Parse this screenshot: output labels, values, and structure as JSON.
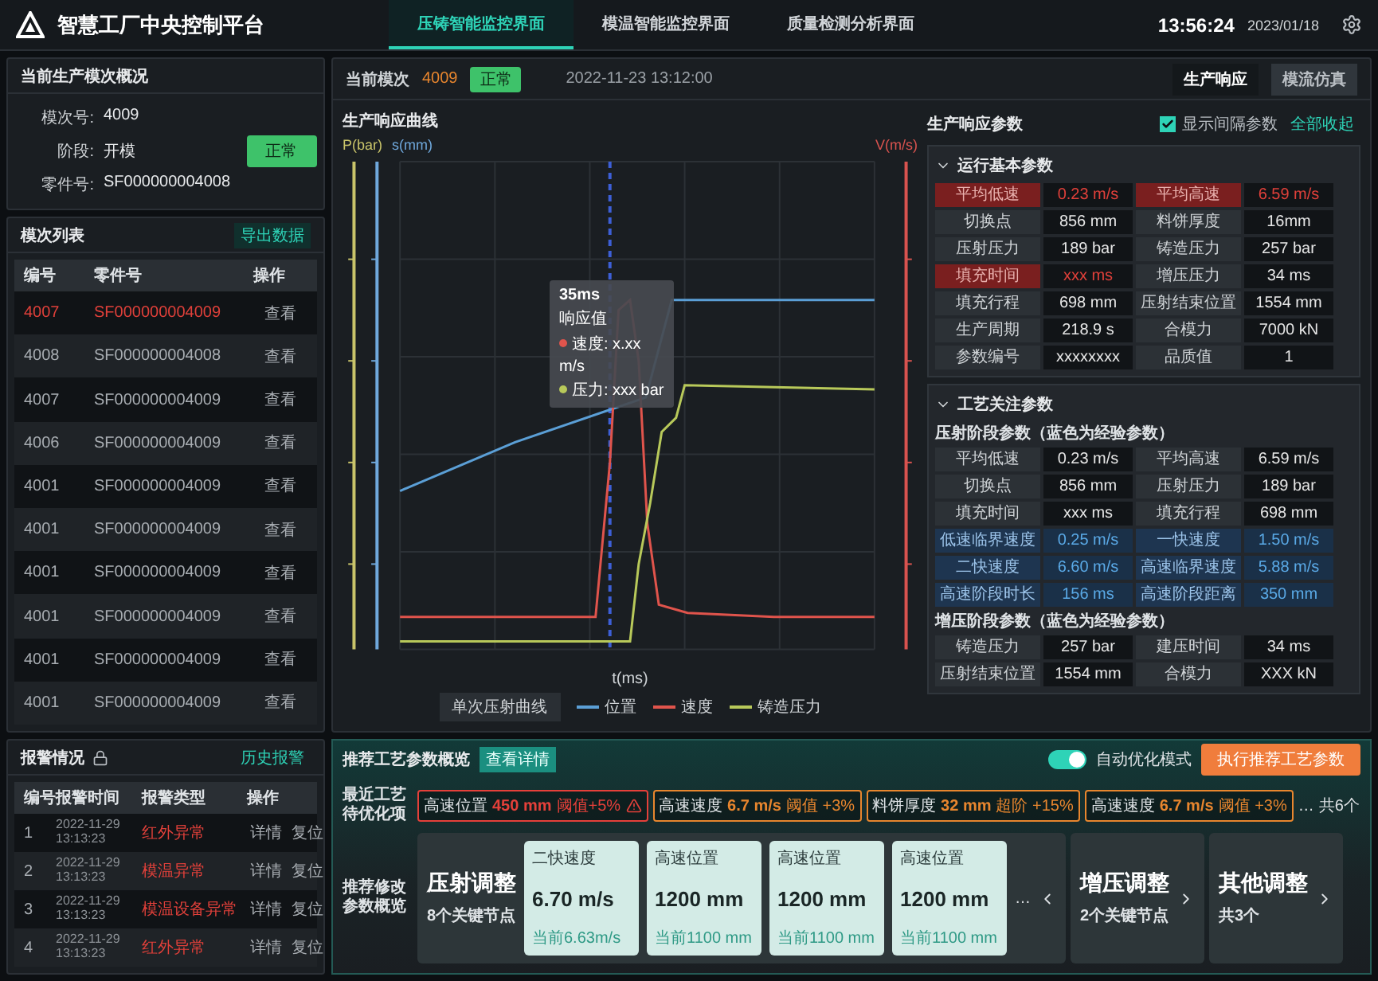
{
  "header": {
    "title": "智慧工厂中央控制平台",
    "tabs": [
      {
        "label": "压铸智能监控界面",
        "selected": true
      },
      {
        "label": "模温智能监控界面",
        "selected": false
      },
      {
        "label": "质量检测分析界面",
        "selected": false
      }
    ],
    "time": "13:56:24",
    "date": "2023/01/18"
  },
  "overview": {
    "title": "当前生产模次概况",
    "fields": [
      {
        "label": "模次号:",
        "value": "4009"
      },
      {
        "label": "阶段:",
        "value": "开模"
      },
      {
        "label": "零件号:",
        "value": "SF000000004008"
      }
    ],
    "status": "正常"
  },
  "cycle_list": {
    "title": "模次列表",
    "action": "导出数据",
    "columns": [
      "编号",
      "零件号",
      "操作"
    ],
    "rows": [
      {
        "id": "4007",
        "part": "SF000000004009",
        "action": "查看",
        "alert": true
      },
      {
        "id": "4008",
        "part": "SF000000004008",
        "action": "查看",
        "alert": false
      },
      {
        "id": "4007",
        "part": "SF000000004009",
        "action": "查看",
        "alert": false
      },
      {
        "id": "4006",
        "part": "SF000000004009",
        "action": "查看",
        "alert": false
      },
      {
        "id": "4001",
        "part": "SF000000004009",
        "action": "查看",
        "alert": false
      },
      {
        "id": "4001",
        "part": "SF000000004009",
        "action": "查看",
        "alert": false
      },
      {
        "id": "4001",
        "part": "SF000000004009",
        "action": "查看",
        "alert": false
      },
      {
        "id": "4001",
        "part": "SF000000004009",
        "action": "查看",
        "alert": false
      },
      {
        "id": "4001",
        "part": "SF000000004009",
        "action": "查看",
        "alert": false
      },
      {
        "id": "4001",
        "part": "SF000000004009",
        "action": "查看",
        "alert": false
      }
    ]
  },
  "center": {
    "label": "当前模次",
    "cycle": "4009",
    "status": "正常",
    "timestamp": "2022-11-23 13:12:00",
    "views": [
      {
        "label": "生产响应",
        "selected": true
      },
      {
        "label": "模流仿真",
        "selected": false
      }
    ]
  },
  "chart": {
    "title": "生产响应曲线",
    "axis_left": [
      "P(bar)",
      "s(mm)"
    ],
    "axis_right": "V(m/s)",
    "axis_bottom": "t(ms)",
    "tooltip": {
      "time": "35ms",
      "heading": "响应值",
      "lines": [
        {
          "text": "速度: x.xx",
          "color": "#e0544c"
        },
        {
          "text": "m/s"
        },
        {
          "text": "压力: xxx bar",
          "color": "#b8c95a"
        }
      ]
    },
    "legend": {
      "series_label": "单次压射曲线",
      "items": [
        {
          "label": "位置",
          "color": "#5b9fd6"
        },
        {
          "label": "速度",
          "color": "#e0544c"
        },
        {
          "label": "铸造压力",
          "color": "#b8c95a"
        }
      ]
    }
  },
  "params": {
    "title": "生产响应参数",
    "show_interval": {
      "label": "显示间隔参数",
      "checked": true
    },
    "collapse_all": "全部收起",
    "sections": [
      {
        "title": "运行基本参数",
        "expanded": true,
        "groups": [
          {
            "rows": [
              [
                {
                  "label": "平均低速",
                  "value": "0.23 m/s",
                  "kind": "alarm"
                },
                {
                  "label": "平均高速",
                  "value": "6.59 m/s",
                  "kind": "alarm"
                }
              ],
              [
                {
                  "label": "切换点",
                  "value": "856 mm",
                  "kind": "normal"
                },
                {
                  "label": "料饼厚度",
                  "value": "16mm",
                  "kind": "normal"
                }
              ],
              [
                {
                  "label": "压射压力",
                  "value": "189 bar",
                  "kind": "normal"
                },
                {
                  "label": "铸造压力",
                  "value": "257 bar",
                  "kind": "normal"
                }
              ],
              [
                {
                  "label": "填充时间",
                  "value": "xxx ms",
                  "kind": "alarm"
                },
                {
                  "label": "增压压力",
                  "value": "34 ms",
                  "kind": "normal"
                }
              ],
              [
                {
                  "label": "填充行程",
                  "value": "698 mm",
                  "kind": "normal"
                },
                {
                  "label": "压射结束位置",
                  "value": "1554 mm",
                  "kind": "normal"
                }
              ],
              [
                {
                  "label": "生产周期",
                  "value": "218.9 s",
                  "kind": "normal"
                },
                {
                  "label": "合模力",
                  "value": "7000 kN",
                  "kind": "normal"
                }
              ],
              [
                {
                  "label": "参数编号",
                  "value": "xxxxxxxx",
                  "kind": "normal"
                },
                {
                  "label": "品质值",
                  "value": "1",
                  "kind": "normal"
                }
              ]
            ]
          }
        ]
      },
      {
        "title": "工艺关注参数",
        "expanded": true,
        "groups": [
          {
            "title": "压射阶段参数（蓝色为经验参数）",
            "rows": [
              [
                {
                  "label": "平均低速",
                  "value": "0.23 m/s",
                  "kind": "normal"
                },
                {
                  "label": "平均高速",
                  "value": "6.59 m/s",
                  "kind": "normal"
                }
              ],
              [
                {
                  "label": "切换点",
                  "value": "856 mm",
                  "kind": "normal"
                },
                {
                  "label": "压射压力",
                  "value": "189 bar",
                  "kind": "normal"
                }
              ],
              [
                {
                  "label": "填充时间",
                  "value": "xxx ms",
                  "kind": "normal"
                },
                {
                  "label": "填充行程",
                  "value": "698 mm",
                  "kind": "normal"
                }
              ],
              [
                {
                  "label": "低速临界速度",
                  "value": "0.25 m/s",
                  "kind": "empirical"
                },
                {
                  "label": "一快速度",
                  "value": "1.50 m/s",
                  "kind": "empirical"
                }
              ],
              [
                {
                  "label": "二快速度",
                  "value": "6.60 m/s",
                  "kind": "empirical"
                },
                {
                  "label": "高速临界速度",
                  "value": "5.88 m/s",
                  "kind": "empirical"
                }
              ],
              [
                {
                  "label": "高速阶段时长",
                  "value": "156 ms",
                  "kind": "empirical"
                },
                {
                  "label": "高速阶段距离",
                  "value": "350 mm",
                  "kind": "empirical"
                }
              ]
            ]
          },
          {
            "title": "增压阶段参数（蓝色为经验参数）",
            "rows": [
              [
                {
                  "label": "铸造压力",
                  "value": "257 bar",
                  "kind": "normal"
                },
                {
                  "label": "建压时间",
                  "value": "34 ms",
                  "kind": "normal"
                }
              ],
              [
                {
                  "label": "压射结束位置",
                  "value": "1554 mm",
                  "kind": "normal"
                },
                {
                  "label": "合模力",
                  "value": "XXX kN",
                  "kind": "normal"
                }
              ]
            ]
          }
        ]
      }
    ]
  },
  "alarms": {
    "title": "报警情况",
    "action": "历史报警",
    "columns": [
      "编号",
      "报警时间",
      "报警类型",
      "操作"
    ],
    "rows": [
      {
        "no": "1",
        "time": "2022-11-29 13:13:23",
        "type": "红外异常",
        "actions": [
          "详情",
          "复位"
        ]
      },
      {
        "no": "2",
        "time": "2022-11-29 13:13:23",
        "type": "模温异常",
        "actions": [
          "详情",
          "复位"
        ]
      },
      {
        "no": "3",
        "time": "2022-11-29 13:13:23",
        "type": "模温设备异常",
        "actions": [
          "详情",
          "复位"
        ]
      },
      {
        "no": "4",
        "time": "2022-11-29 13:13:23",
        "type": "红外异常",
        "actions": [
          "详情",
          "复位"
        ]
      }
    ]
  },
  "recommend": {
    "title": "推荐工艺参数概览",
    "detail": "查看详情",
    "auto_mode": {
      "label": "自动优化模式",
      "on": true
    },
    "execute": "执行推荐工艺参数",
    "pending": {
      "label": "最近工艺待优化项",
      "items": [
        {
          "name": "高速位置",
          "value": "450 mm",
          "delta": "阈值+5%",
          "color": "#e5403a",
          "flagged": true
        },
        {
          "name": "高速速度",
          "value": "6.7 m/s",
          "delta": "阈值 +3%",
          "color": "#e8862e",
          "flagged": false
        },
        {
          "name": "料饼厚度",
          "value": "32 mm",
          "delta": "超阶 +15%",
          "color": "#e8862e",
          "flagged": false
        },
        {
          "name": "高速速度",
          "value": "6.7 m/s",
          "delta": "阈值 +3%",
          "color": "#e8862e",
          "flagged": false
        }
      ],
      "more": "…",
      "count": "共6个"
    },
    "plan": {
      "label": "推荐修改参数概览",
      "groups": [
        {
          "title": "压射调整",
          "subtitle": "8个关键节点",
          "expanded": true,
          "more": "…",
          "items": [
            {
              "name": "二快速度",
              "value": "6.70 m/s",
              "current": "当前6.63m/s"
            },
            {
              "name": "高速位置",
              "value": "1200 mm",
              "current": "当前1100 mm"
            },
            {
              "name": "高速位置",
              "value": "1200 mm",
              "current": "当前1100 mm"
            },
            {
              "name": "高速位置",
              "value": "1200 mm",
              "current": "当前1100 mm"
            }
          ]
        },
        {
          "title": "增压调整",
          "subtitle": "2个关键节点",
          "expanded": false
        },
        {
          "title": "其他调整",
          "subtitle": "共3个",
          "expanded": false
        }
      ]
    }
  }
}
